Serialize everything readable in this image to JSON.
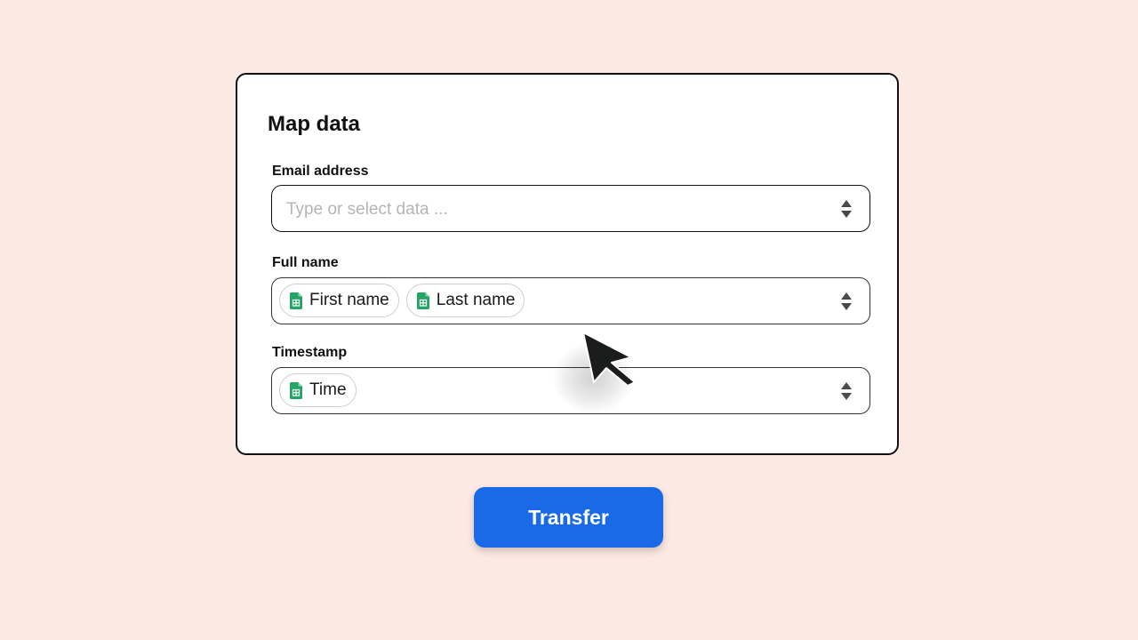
{
  "card": {
    "title": "Map data"
  },
  "fields": {
    "email": {
      "label": "Email address",
      "placeholder": "Type or select data ...",
      "value": ""
    },
    "full_name": {
      "label": "Full name",
      "pills": [
        {
          "label": "First name",
          "icon": "google-sheets-icon"
        },
        {
          "label": "Last name",
          "icon": "google-sheets-icon"
        }
      ]
    },
    "timestamp": {
      "label": "Timestamp",
      "pills": [
        {
          "label": "Time",
          "icon": "google-sheets-icon"
        }
      ]
    }
  },
  "actions": {
    "transfer_label": "Transfer"
  },
  "colors": {
    "background": "#fbe9e3",
    "primary_button": "#1a6ae8",
    "sheets_green": "#23a566"
  }
}
